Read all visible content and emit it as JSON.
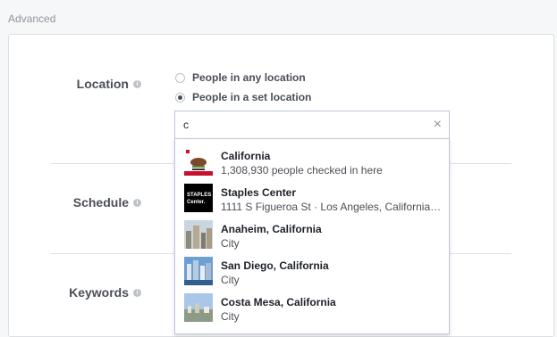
{
  "section": {
    "title": "Advanced"
  },
  "location": {
    "label": "Location",
    "info_icon": "i",
    "options": [
      {
        "label": "People in any location",
        "checked": false
      },
      {
        "label": "People in a set location",
        "checked": true
      }
    ],
    "search": {
      "value": "c",
      "clear_icon": "×"
    },
    "results": [
      {
        "title": "California",
        "subtitle": "1,308,930 people checked in here",
        "thumb": "california-flag"
      },
      {
        "title": "Staples Center",
        "subtitle": "1111 S Figueroa St · Los Angeles, California · …",
        "thumb": "staples-logo",
        "thumb_text": "STAPLES Center."
      },
      {
        "title": "Anaheim, California",
        "subtitle": "City",
        "thumb": "city-photo"
      },
      {
        "title": "San Diego, California",
        "subtitle": "City",
        "thumb": "city-photo"
      },
      {
        "title": "Costa Mesa, California",
        "subtitle": "City",
        "thumb": "city-photo"
      }
    ]
  },
  "schedule": {
    "label": "Schedule",
    "info_icon": "i"
  },
  "keywords": {
    "label": "Keywords",
    "info_icon": "i"
  },
  "colors": {
    "accent": "#4b4f56",
    "border": "#dddfe2"
  }
}
